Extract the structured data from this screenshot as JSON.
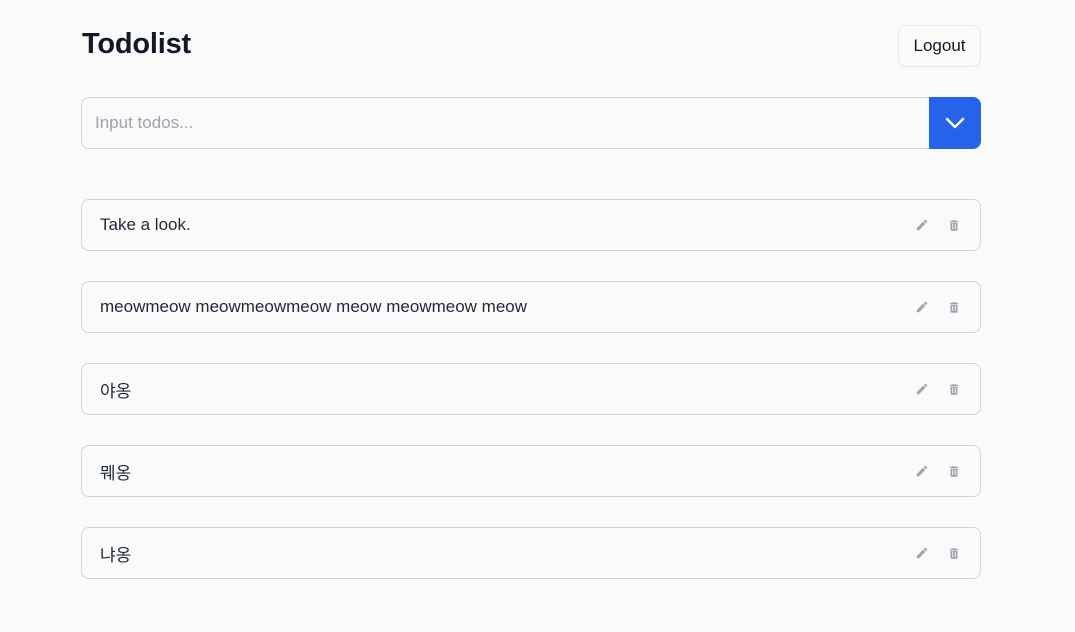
{
  "header": {
    "title": "Todolist",
    "logout_label": "Logout"
  },
  "input": {
    "placeholder": "Input todos...",
    "value": "",
    "submit_icon": "chevron-down-icon"
  },
  "todos": [
    {
      "text": "Take a look."
    },
    {
      "text": "meowmeow meowmeowmeow meow meowmeow meow"
    },
    {
      "text": "야옹"
    },
    {
      "text": "뭬옹"
    },
    {
      "text": "냐옹"
    }
  ],
  "icons": {
    "edit": "pencil-icon",
    "delete": "trash-icon"
  },
  "colors": {
    "accent": "#2563eb",
    "icon": "#9ca3af",
    "border": "#d1d5db",
    "background": "#fafafa"
  }
}
